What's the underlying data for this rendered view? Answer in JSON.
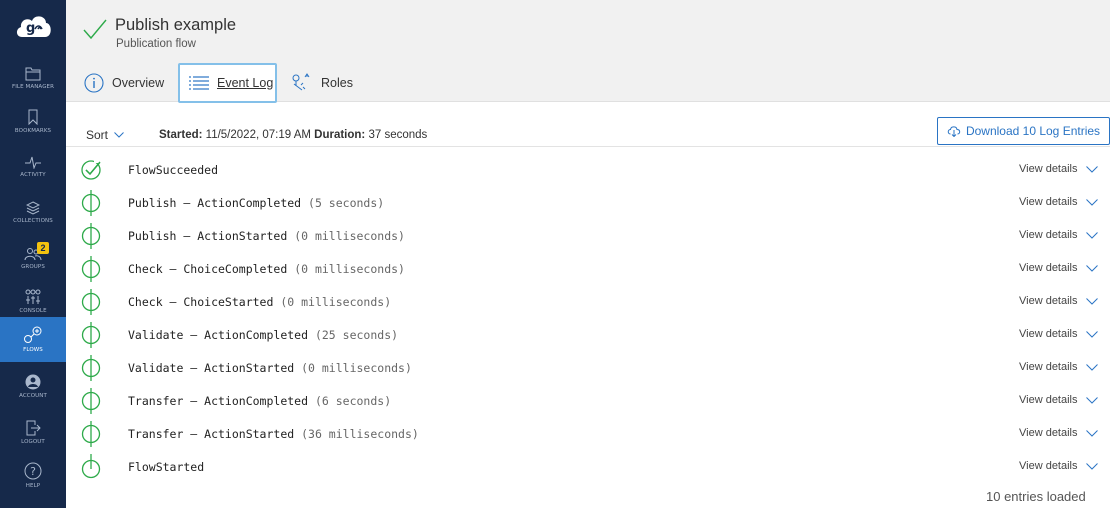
{
  "colors": {
    "sidebar_bg": "#16294a",
    "sidebar_active": "#2a74c4",
    "success_green": "#2eaa4a",
    "link_blue": "#2a74c4",
    "badge_yellow": "#f2c20f"
  },
  "sidebar": {
    "items": [
      {
        "label": "FILE MANAGER",
        "icon": "folder-icon"
      },
      {
        "label": "BOOKMARKS",
        "icon": "bookmark-icon"
      },
      {
        "label": "ACTIVITY",
        "icon": "activity-icon"
      },
      {
        "label": "COLLECTIONS",
        "icon": "collections-icon"
      },
      {
        "label": "GROUPS",
        "icon": "groups-icon",
        "badge": "2"
      },
      {
        "label": "CONSOLE",
        "icon": "console-icon"
      },
      {
        "label": "FLOWS",
        "icon": "flows-icon",
        "active": true
      },
      {
        "label": "ACCOUNT",
        "icon": "account-icon"
      },
      {
        "label": "LOGOUT",
        "icon": "logout-icon"
      },
      {
        "label": "HELP",
        "icon": "help-icon"
      }
    ]
  },
  "header": {
    "title": "Publish example",
    "subtitle": "Publication flow",
    "tabs": [
      {
        "label": "Overview",
        "icon": "info-icon"
      },
      {
        "label": "Event Log",
        "icon": "list-icon",
        "active": true
      },
      {
        "label": "Roles",
        "icon": "roles-icon"
      }
    ]
  },
  "toolbar": {
    "sort_label": "Sort",
    "started_label": "Started:",
    "started_value": "11/5/2022, 07:19 AM",
    "duration_label": "Duration:",
    "duration_value": "37 seconds",
    "download_label": "Download 10 Log Entries"
  },
  "log": {
    "view_details_label": "View details",
    "entries": [
      {
        "event": "FlowSucceeded",
        "duration": "",
        "status": "succeeded"
      },
      {
        "event": "Publish – ActionCompleted",
        "duration": "(5 seconds)",
        "status": "step"
      },
      {
        "event": "Publish – ActionStarted",
        "duration": "(0 milliseconds)",
        "status": "step"
      },
      {
        "event": "Check – ChoiceCompleted",
        "duration": "(0 milliseconds)",
        "status": "step"
      },
      {
        "event": "Check – ChoiceStarted",
        "duration": "(0 milliseconds)",
        "status": "step"
      },
      {
        "event": "Validate – ActionCompleted",
        "duration": "(25 seconds)",
        "status": "step"
      },
      {
        "event": "Validate – ActionStarted",
        "duration": "(0 milliseconds)",
        "status": "step"
      },
      {
        "event": "Transfer – ActionCompleted",
        "duration": "(6 seconds)",
        "status": "step"
      },
      {
        "event": "Transfer – ActionStarted",
        "duration": "(36 milliseconds)",
        "status": "step"
      },
      {
        "event": "FlowStarted",
        "duration": "",
        "status": "started"
      }
    ],
    "entries_loaded": "10 entries loaded"
  }
}
